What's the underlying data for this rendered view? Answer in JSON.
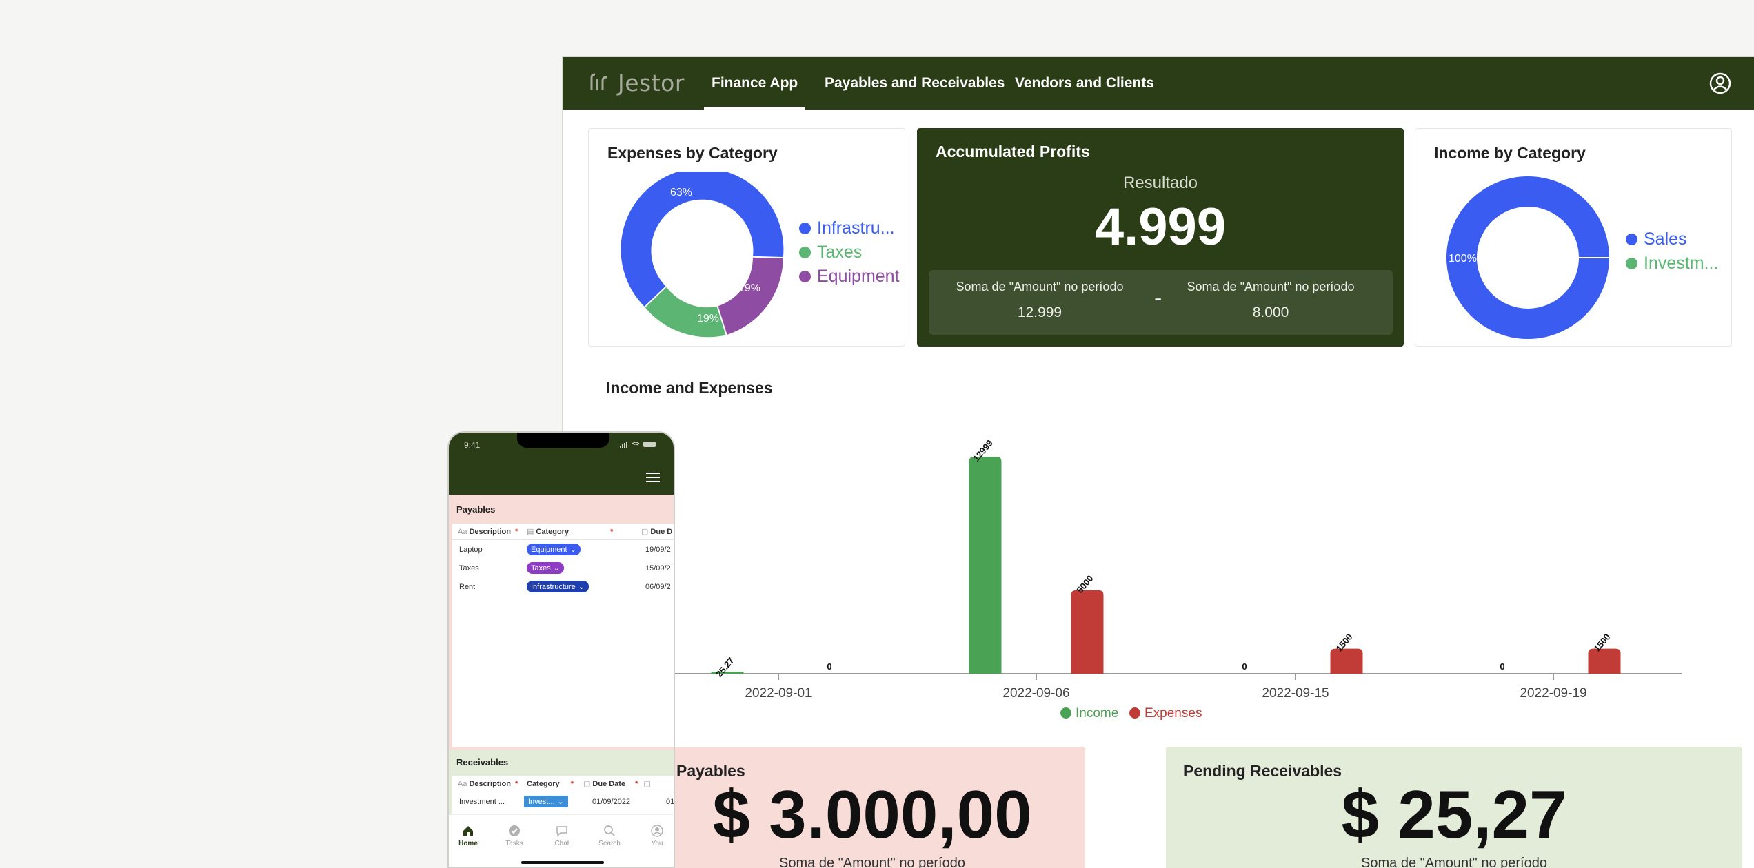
{
  "app": {
    "logo_text": "Jestor",
    "nav": [
      "Finance App",
      "Payables and Receivables",
      "Vendors and Clients"
    ],
    "active_tab": "Finance App"
  },
  "expenses_card": {
    "title": "Expenses by Category",
    "legend": [
      {
        "label": "Infrastru...",
        "color": "#3a5cf0"
      },
      {
        "label": "Taxes",
        "color": "#5db574"
      },
      {
        "label": "Equipment",
        "color": "#8e4ca2"
      }
    ],
    "slice_labels": [
      "63%",
      "19%",
      "19%"
    ]
  },
  "profits_card": {
    "title": "Accumulated Profits",
    "result_label": "Resultado",
    "result_value": "4.999",
    "left_label": "Soma de \"Amount\" no período",
    "left_value": "12.999",
    "operator": "-",
    "right_label": "Soma de \"Amount\" no período",
    "right_value": "8.000"
  },
  "income_card": {
    "title": "Income by Category",
    "legend": [
      {
        "label": "Sales",
        "color": "#3a5cf0"
      },
      {
        "label": "Investm...",
        "color": "#5db574"
      }
    ],
    "slice_labels": [
      "100%"
    ]
  },
  "chart_section": {
    "title": "Income and Expenses"
  },
  "chart_data": {
    "type": "bar",
    "title": "Income and Expenses",
    "categories": [
      "2022-09-01",
      "2022-09-06",
      "2022-09-15",
      "2022-09-19"
    ],
    "series": [
      {
        "name": "Income",
        "color": "#4aa354",
        "values": [
          25.27,
          12999,
          0,
          0
        ]
      },
      {
        "name": "Expenses",
        "color": "#c23c37",
        "values": [
          0,
          5000,
          1500,
          1500
        ]
      }
    ],
    "data_labels": {
      "Income": [
        "25.27",
        "12999",
        "0",
        "0"
      ],
      "Expenses": [
        "0",
        "5000",
        "1500",
        "1500"
      ]
    },
    "legend_position": "bottom-center",
    "grid": false
  },
  "payables_card": {
    "title": "Payables",
    "value": "$ 3.000,00",
    "sub": "Soma de \"Amount\" no período"
  },
  "receivables_card": {
    "title": "Pending Receivables",
    "value": "$ 25,27",
    "sub": "Soma de \"Amount\" no período"
  },
  "phone": {
    "time": "9:41",
    "payables": {
      "title": "Payables",
      "columns": [
        "Description",
        "Category",
        "Due D"
      ],
      "rows": [
        {
          "description": "Laptop",
          "category": "Equipment",
          "category_color": "#3a5cf0",
          "due": "19/09/2"
        },
        {
          "description": "Taxes",
          "category": "Taxes",
          "category_color": "#8e3cc4",
          "due": "15/09/2"
        },
        {
          "description": "Rent",
          "category": "Infrastructure",
          "category_color": "#1f3fb0",
          "due": "06/09/2"
        }
      ]
    },
    "receivables": {
      "title": "Receivables",
      "columns": [
        "Description",
        "Category",
        "Due Date"
      ],
      "rows": [
        {
          "description": "Investment ...",
          "category": "Invest...",
          "category_color": "#3a8fd8",
          "due": "01/09/2022",
          "extra": "01"
        }
      ]
    },
    "tabs": [
      "Home",
      "Tasks",
      "Chat",
      "Search",
      "You"
    ],
    "active_tab": "Home"
  }
}
